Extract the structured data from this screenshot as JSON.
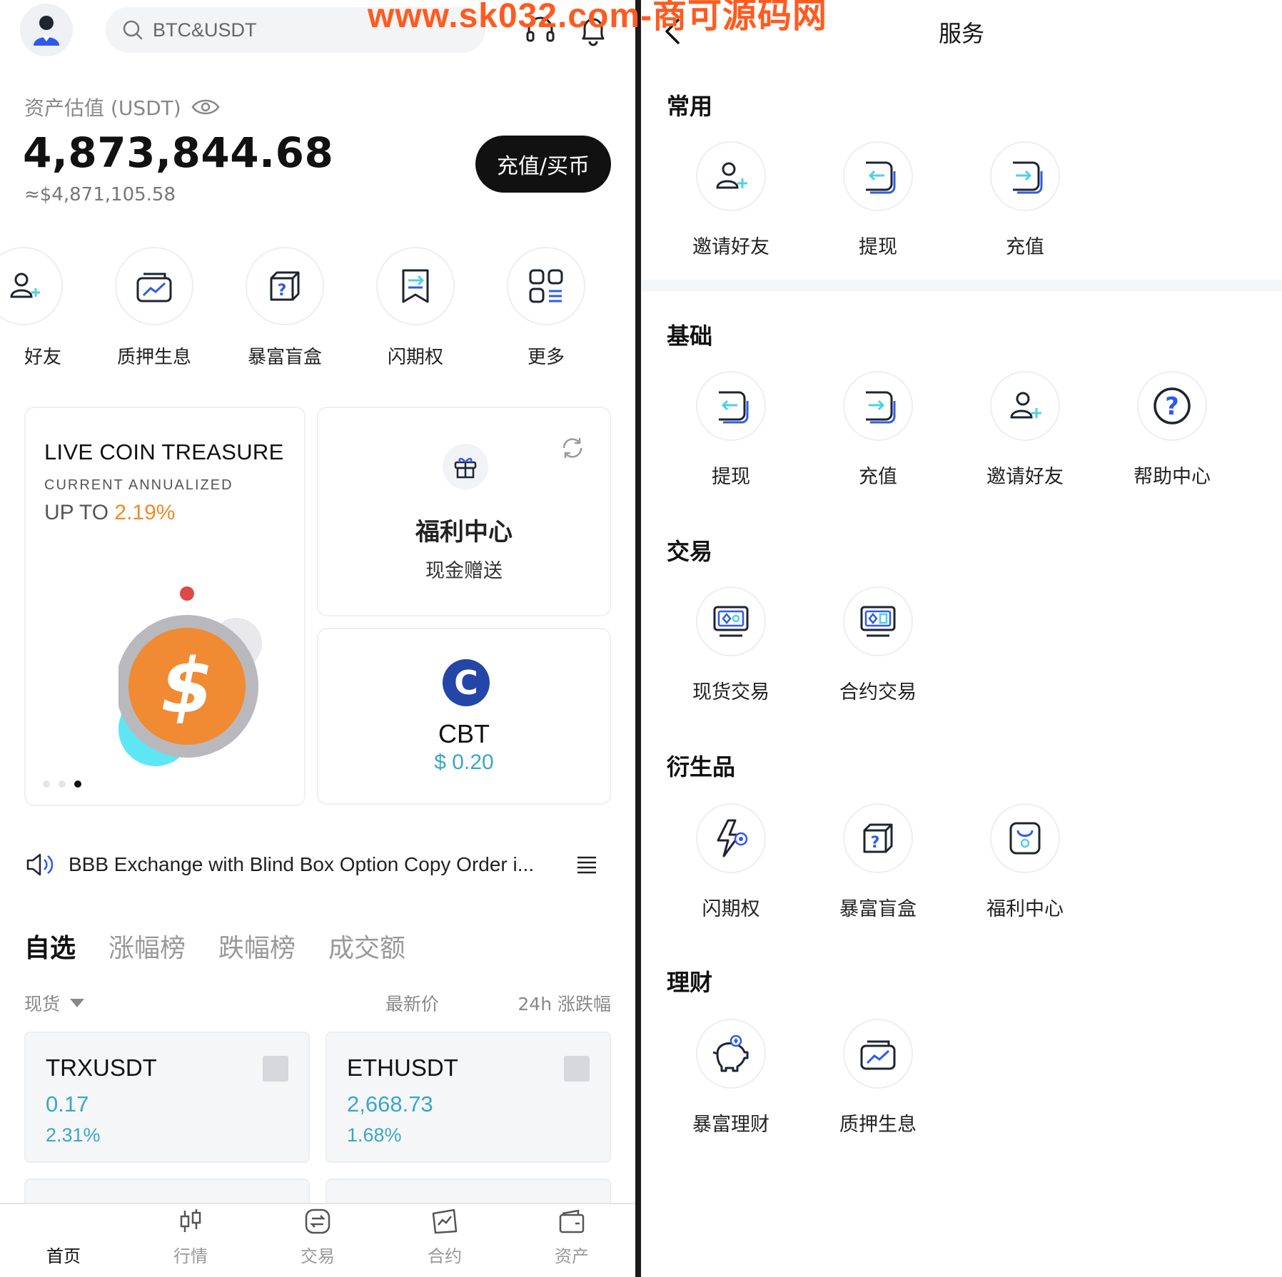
{
  "watermark": "www.sk032.com-商可源码网",
  "header": {
    "search_placeholder": "BTC&USDT"
  },
  "assets": {
    "label": "资产估值 (USDT)",
    "value": "4,873,844.68",
    "approx": "≈$4,871,105.58",
    "deposit_label": "充值/买币"
  },
  "quick_actions": [
    {
      "label": "好友",
      "icon": "invite-friend-icon"
    },
    {
      "label": "质押生息",
      "icon": "staking-chart-icon"
    },
    {
      "label": "暴富盲盒",
      "icon": "blind-box-icon"
    },
    {
      "label": "闪期权",
      "icon": "flash-option-icon"
    },
    {
      "label": "更多",
      "icon": "more-grid-icon"
    }
  ],
  "treasure": {
    "title": "LIVE COIN TREASURE",
    "subtitle": "CURRENT ANNUALIZED",
    "up_to": "UP TO ",
    "rate": "2.19%"
  },
  "welfare": {
    "title": "福利中心",
    "subtitle": "现金赠送"
  },
  "coin": {
    "symbol": "CBT",
    "price": "$ 0.20",
    "logo_letter": "C"
  },
  "notice": {
    "text": "BBB Exchange with Blind Box Option Copy Order i..."
  },
  "market_tabs": [
    {
      "label": "自选",
      "active": true
    },
    {
      "label": "涨幅榜",
      "active": false
    },
    {
      "label": "跌幅榜",
      "active": false
    },
    {
      "label": "成交额",
      "active": false
    }
  ],
  "market_header": {
    "type": "现货",
    "price": "最新价",
    "change": "24h 涨跌幅"
  },
  "market_cards": [
    {
      "symbol": "TRXUSDT",
      "price": "0.17",
      "change": "2.31%"
    },
    {
      "symbol": "ETHUSDT",
      "price": "2,668.73",
      "change": "1.68%"
    }
  ],
  "bottom_nav": [
    {
      "label": "首页",
      "active": true
    },
    {
      "label": "行情",
      "active": false
    },
    {
      "label": "交易",
      "active": false
    },
    {
      "label": "合约",
      "active": false
    },
    {
      "label": "资产",
      "active": false
    }
  ],
  "services": {
    "title": "服务",
    "sections": [
      {
        "title": "常用",
        "items": [
          "邀请好友",
          "提现",
          "充值"
        ]
      },
      {
        "title": "基础",
        "items": [
          "提现",
          "充值",
          "邀请好友",
          "帮助中心"
        ]
      },
      {
        "title": "交易",
        "items": [
          "现货交易",
          "合约交易"
        ]
      },
      {
        "title": "衍生品",
        "items": [
          "闪期权",
          "暴富盲盒",
          "福利中心"
        ]
      },
      {
        "title": "理财",
        "items": [
          "暴富理财",
          "质押生息"
        ]
      }
    ]
  },
  "colors": {
    "accent_orange": "#f08a24",
    "price_teal": "#3aa6c9",
    "icon_blue": "#2f5bea",
    "icon_cyan": "#4fd1e0"
  }
}
